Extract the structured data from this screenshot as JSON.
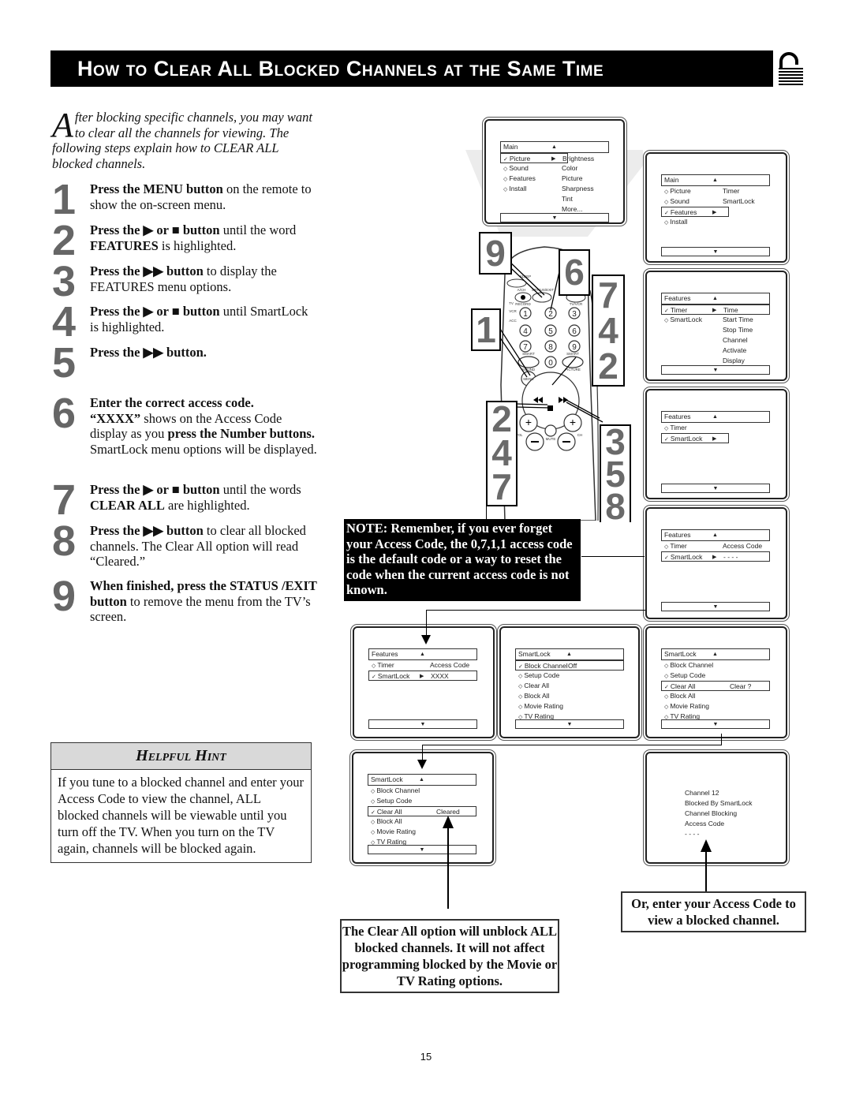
{
  "header": {
    "title": "How to Clear All Blocked Channels at the Same Time",
    "icon": "padlock-open-icon"
  },
  "intro": {
    "dropcap": "A",
    "text": "fter blocking specific channels, you may want to clear all the channels for viewing. The following steps explain how to CLEAR ALL blocked channels."
  },
  "steps": [
    {
      "num": "1",
      "bold": "Press the MENU button",
      "rest": " on the remote to show the on-screen menu."
    },
    {
      "num": "2",
      "bold": "Press the ▶ or ■ button",
      "rest": " until the word ",
      "bold2": "FEATURES",
      "rest2": " is highlighted."
    },
    {
      "num": "3",
      "bold": "Press the ▶▶ button",
      "rest": " to display the FEATURES menu options."
    },
    {
      "num": "4",
      "bold": "Press the ▶ or ■ button",
      "rest": " until SmartLock is highlighted."
    },
    {
      "num": "5",
      "bold": "Press the ▶▶ button.",
      "rest": ""
    },
    {
      "num": "6",
      "bold": "Enter the correct access code.",
      "bold_b": "“XXXX”",
      "rest": " shows on the Access Code display as you ",
      "bold2": "press the Number buttons.",
      "rest2": " SmartLock menu options will be displayed."
    },
    {
      "num": "7",
      "bold": "Press the ▶ or ■ button",
      "rest": " until the words ",
      "bold2": "CLEAR ALL",
      "rest2": " are highlighted."
    },
    {
      "num": "8",
      "bold": "Press the ▶▶ button",
      "rest": " to clear all blocked channels. The Clear All option will read “Cleared.”"
    },
    {
      "num": "9",
      "bold": "When finished, press the STATUS /EXIT button",
      "rest": " to remove the menu from the TV’s screen."
    }
  ],
  "hint": {
    "title": "Helpful Hint",
    "text": "If you tune to a blocked channel and enter your Access Code to view the channel, ALL blocked channels will be viewable until you turn off the TV. When you turn on the TV again, channels will be blocked again."
  },
  "note": {
    "text": "NOTE: Remember, if you ever forget your Access Code, the 0,7,1,1 access code is the default code or a way to reset the code when the current access code is not known."
  },
  "clear_all_box": {
    "text": "The Clear All option will unblock ALL blocked channels. It will not affect programming blocked by the Movie or TV Rating options."
  },
  "access_box": {
    "text": "Or, enter your Access Code to view a blocked channel."
  },
  "remote": {
    "callouts": [
      "9",
      "6",
      "7 4 2",
      "1",
      "2 4 7",
      "3 5 8"
    ],
    "labels": {
      "sleep": "SLEEP",
      "status": "STATUS/EXIT",
      "ach": "A/CH",
      "record": "RECORD",
      "tvvcr": "TV/VCR",
      "tv": "TV",
      "vcr": "VCR",
      "acc": "ACC",
      "smart1": "SMART",
      "smart2": "SMART",
      "sound": "SOUND",
      "picture": "PICTURE",
      "menu": "MENU",
      "vol": "VOL",
      "ch": "CH",
      "mute": "MUTE"
    },
    "keys": [
      "1",
      "2",
      "3",
      "4",
      "5",
      "6",
      "7",
      "8",
      "9",
      "0"
    ]
  },
  "screens": {
    "s1": {
      "head": "Main",
      "rows": [
        {
          "l": "Picture",
          "mark": "check",
          "hl": true,
          "r": "Brightness"
        },
        {
          "l": "Sound",
          "mark": "diamond",
          "r": "Color"
        },
        {
          "l": "Features",
          "mark": "diamond",
          "r": "Picture"
        },
        {
          "l": "Install",
          "mark": "diamond",
          "r": "Sharpness"
        },
        {
          "l": "",
          "r": "Tint"
        },
        {
          "l": "",
          "r": "More..."
        }
      ]
    },
    "s2": {
      "head": "Main",
      "rows": [
        {
          "l": "Picture",
          "mark": "diamond",
          "r": "Timer"
        },
        {
          "l": "Sound",
          "mark": "diamond",
          "r": "SmartLock"
        },
        {
          "l": "Features",
          "mark": "check",
          "hl": true,
          "r": ""
        },
        {
          "l": "Install",
          "mark": "diamond",
          "r": ""
        }
      ]
    },
    "s3": {
      "head": "Features",
      "rows": [
        {
          "l": "Timer",
          "mark": "check",
          "hl": true,
          "r": "Time"
        },
        {
          "l": "SmartLock",
          "mark": "diamond",
          "r": "Start Time"
        },
        {
          "l": "",
          "r": "Stop Time"
        },
        {
          "l": "",
          "r": "Channel"
        },
        {
          "l": "",
          "r": "Activate"
        },
        {
          "l": "",
          "r": "Display"
        }
      ]
    },
    "s4": {
      "head": "Features",
      "rows": [
        {
          "l": "Timer",
          "mark": "diamond",
          "r": ""
        },
        {
          "l": "SmartLock",
          "mark": "check",
          "hl": true,
          "r": ""
        }
      ]
    },
    "s5": {
      "head": "Features",
      "rows": [
        {
          "l": "Timer",
          "mark": "diamond",
          "r": "Access Code"
        },
        {
          "l": "SmartLock",
          "mark": "check",
          "hl": true,
          "r": "- - - -"
        }
      ]
    },
    "s6": {
      "head": "Features",
      "rows": [
        {
          "l": "Timer",
          "mark": "diamond",
          "r": "Access Code"
        },
        {
          "l": "SmartLock",
          "mark": "check",
          "hl": true,
          "r": "XXXX"
        }
      ]
    },
    "s7": {
      "head": "SmartLock",
      "rows": [
        {
          "l": "Block Channel",
          "mark": "check",
          "hl": true,
          "r": "Off"
        },
        {
          "l": "Setup Code",
          "mark": "diamond",
          "r": ""
        },
        {
          "l": "Clear All",
          "mark": "diamond",
          "r": ""
        },
        {
          "l": "Block All",
          "mark": "diamond",
          "r": ""
        },
        {
          "l": "Movie Rating",
          "mark": "diamond",
          "r": ""
        },
        {
          "l": "TV Rating",
          "mark": "diamond",
          "r": ""
        }
      ]
    },
    "s8": {
      "head": "SmartLock",
      "rows": [
        {
          "l": "Block Channel",
          "mark": "diamond",
          "r": ""
        },
        {
          "l": "Setup Code",
          "mark": "diamond",
          "r": ""
        },
        {
          "l": "Clear All",
          "mark": "check",
          "hl": true,
          "r": "Clear ?"
        },
        {
          "l": "Block All",
          "mark": "diamond",
          "r": ""
        },
        {
          "l": "Movie Rating",
          "mark": "diamond",
          "r": ""
        },
        {
          "l": "TV Rating",
          "mark": "diamond",
          "r": ""
        }
      ]
    },
    "s9": {
      "head": "SmartLock",
      "rows": [
        {
          "l": "Block Channel",
          "mark": "diamond",
          "r": ""
        },
        {
          "l": "Setup Code",
          "mark": "diamond",
          "r": ""
        },
        {
          "l": "Clear All",
          "mark": "check",
          "hl": true,
          "r": "Cleared"
        },
        {
          "l": "Block All",
          "mark": "diamond",
          "r": ""
        },
        {
          "l": "Movie Rating",
          "mark": "diamond",
          "r": ""
        },
        {
          "l": "TV Rating",
          "mark": "diamond",
          "r": ""
        }
      ]
    },
    "s10": {
      "lines": [
        "Channel 12",
        "Blocked By SmartLock",
        "Channel Blocking",
        "Access Code",
        "- - - -"
      ]
    }
  },
  "page_number": "15"
}
